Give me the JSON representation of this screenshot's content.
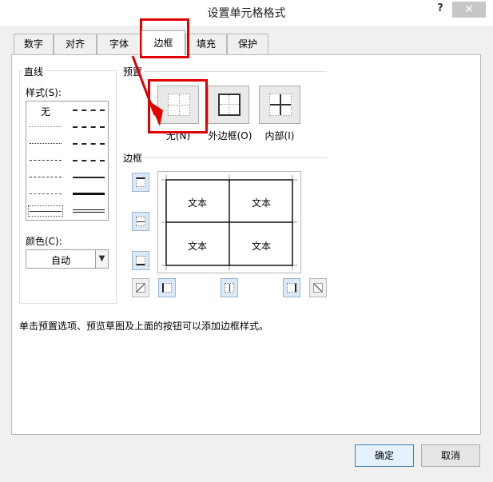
{
  "window": {
    "title": "设置单元格格式",
    "help": "?",
    "close": "✕"
  },
  "tabs": [
    {
      "label": "数字"
    },
    {
      "label": "对齐"
    },
    {
      "label": "字体"
    },
    {
      "label": "边框",
      "active": true
    },
    {
      "label": "填充"
    },
    {
      "label": "保护"
    }
  ],
  "line": {
    "group_label": "直线",
    "style_label": "样式(S):",
    "none_label": "无",
    "color_label": "颜色(C):",
    "color_value": "自动"
  },
  "presets": {
    "group_label": "预置",
    "items": [
      {
        "label": "无(N)"
      },
      {
        "label": "外边框(O)"
      },
      {
        "label": "内部(I)"
      }
    ]
  },
  "border": {
    "group_label": "边框",
    "preview_cells": [
      "文本",
      "文本",
      "文本",
      "文本"
    ]
  },
  "hint": "单击预置选项、预览草图及上面的按钮可以添加边框样式。",
  "buttons": {
    "ok": "确定",
    "cancel": "取消"
  },
  "colors": {
    "highlight": "#e00000",
    "toggle_active": "#dbe8f6"
  }
}
